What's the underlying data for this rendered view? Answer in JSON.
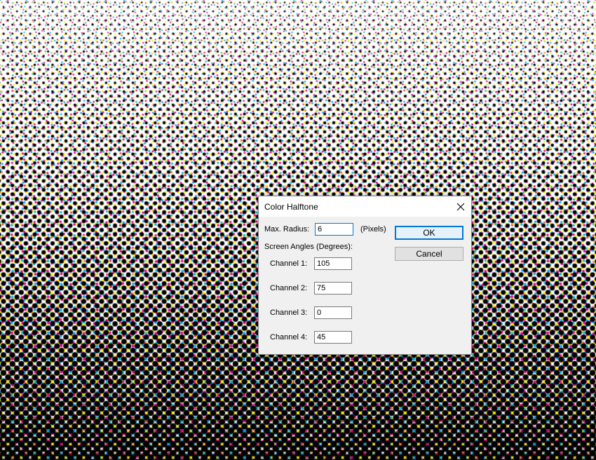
{
  "dialog": {
    "title": "Color Halftone",
    "max_radius_label": "Max. Radius:",
    "max_radius_value": "6",
    "max_radius_unit": "(Pixels)",
    "screen_angles_label": "Screen Angles (Degrees):",
    "channels": [
      {
        "label": "Channel 1:",
        "value": "105"
      },
      {
        "label": "Channel 2:",
        "value": "75"
      },
      {
        "label": "Channel 3:",
        "value": "0"
      },
      {
        "label": "Channel 4:",
        "value": "45"
      }
    ],
    "ok_label": "OK",
    "cancel_label": "Cancel"
  },
  "colors": {
    "accent": "#0078d7",
    "halftone": [
      "#00aeef",
      "#ec008c",
      "#fff200",
      "#000000"
    ]
  },
  "icons": {
    "close": "close-icon"
  }
}
